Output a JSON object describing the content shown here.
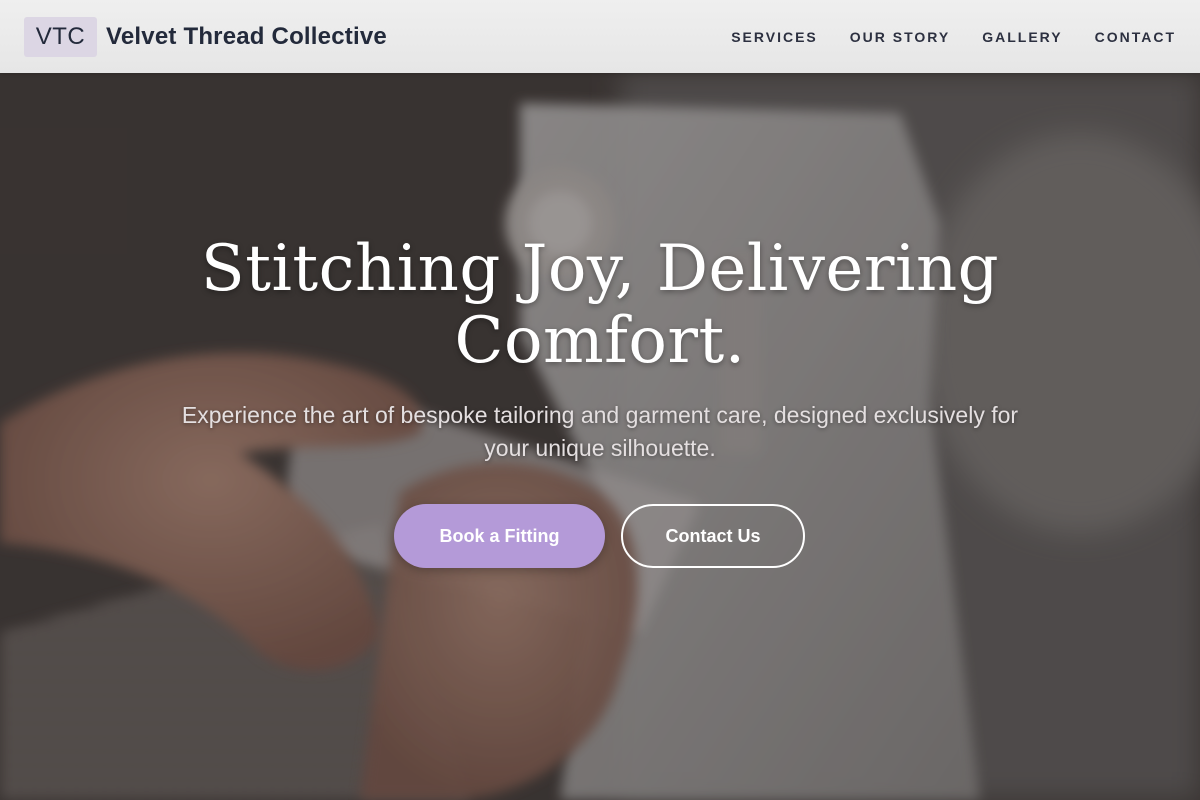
{
  "brand": {
    "logo_text": "VTC",
    "name": "Velvet Thread Collective"
  },
  "nav": {
    "items": [
      "SERVICES",
      "OUR STORY",
      "GALLERY",
      "CONTACT"
    ]
  },
  "hero": {
    "headline": "Stitching Joy, Delivering Comfort.",
    "subheadline": "Experience the art of bespoke tailoring and garment care, designed exclusively for your unique silhouette.",
    "primary_cta": "Book a Fitting",
    "secondary_cta": "Contact Us",
    "background_image": "sewing-machine-hands-photo"
  },
  "colors": {
    "accent": "#b49ad8",
    "logo_bg": "#dcd6e4",
    "text_dark": "#232a3b"
  }
}
